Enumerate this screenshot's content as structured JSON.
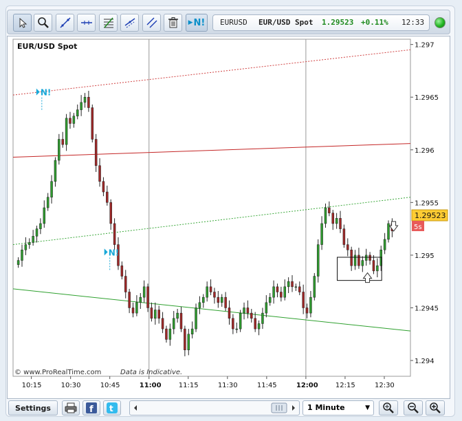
{
  "toolbar": {
    "tools": [
      {
        "name": "pointer-tool-button",
        "icon": "arrow-pointer-icon"
      },
      {
        "name": "zoom-tool-button",
        "icon": "magnifier-icon"
      },
      {
        "name": "trendline-tool-button",
        "icon": "diagonal-line-icon"
      },
      {
        "name": "horizontal-line-tool-button",
        "icon": "horizontal-line-icon"
      },
      {
        "name": "fibonacci-tool-button",
        "icon": "fibonacci-icon"
      },
      {
        "name": "channel-tool-button",
        "icon": "channel-icon"
      },
      {
        "name": "parallel-lines-tool-button",
        "icon": "parallel-lines-icon"
      },
      {
        "name": "delete-tool-button",
        "icon": "trash-icon"
      }
    ],
    "news_label": "N!"
  },
  "quote": {
    "symbol": "EURUSD",
    "name": "EUR/USD Spot",
    "price": "1.29523",
    "change": "+0.11%",
    "time": "12:33",
    "price_color": "#1f8a1f",
    "change_color": "#1f8a1f"
  },
  "chart": {
    "title": "EUR/USD Spot",
    "copyright": "©  www.ProRealTime.com",
    "disclaimer": "Data is Indicative.",
    "news_marker_label": "N!",
    "price_tag": "1.29523",
    "countdown": "5s",
    "price_tag_color": "#ffcc33",
    "countdown_color": "#e85a5a"
  },
  "bottombar": {
    "settings_label": "Settings",
    "interval": "1 Minute",
    "icons": [
      "printer-icon",
      "facebook-icon",
      "twitter-icon",
      "zoom-fit-icon",
      "zoom-out-icon",
      "zoom-in-icon"
    ]
  },
  "chart_data": {
    "type": "candlestick",
    "instrument": "EUR/USD Spot",
    "ylim": [
      1.29385,
      1.29705
    ],
    "y_ticks": [
      "1.297",
      "1.2965",
      "1.296",
      "1.2955",
      "1.295",
      "1.2945",
      "1.294"
    ],
    "x_ticks": [
      "10:15",
      "10:30",
      "10:45",
      "11:00",
      "11:15",
      "11:30",
      "11:45",
      "12:00",
      "12:15",
      "12:30"
    ],
    "x_ticks_bold": [
      "11:00",
      "12:00"
    ],
    "last_price": 1.29523,
    "candle_interval": "1 Minute",
    "series_close": [
      1.29495,
      1.29505,
      1.2951,
      1.29512,
      1.29518,
      1.29525,
      1.2953,
      1.29545,
      1.29555,
      1.2957,
      1.2959,
      1.2961,
      1.29605,
      1.2963,
      1.29625,
      1.29632,
      1.29638,
      1.29645,
      1.2965,
      1.2964,
      1.2961,
      1.29585,
      1.2957,
      1.2956,
      1.2955,
      1.2953,
      1.2951,
      1.2949,
      1.2948,
      1.29465,
      1.2945,
      1.29445,
      1.29455,
      1.2946,
      1.2947,
      1.2945,
      1.2944,
      1.29448,
      1.2944,
      1.2943,
      1.2942,
      1.2943,
      1.2944,
      1.29445,
      1.2943,
      1.2941,
      1.29425,
      1.2943,
      1.2945,
      1.29455,
      1.2946,
      1.2947,
      1.29465,
      1.2946,
      1.29455,
      1.2946,
      1.2945,
      1.2944,
      1.2943,
      1.2943,
      1.29445,
      1.2945,
      1.29445,
      1.2944,
      1.2943,
      1.29435,
      1.29445,
      1.29455,
      1.2946,
      1.2947,
      1.29465,
      1.2946,
      1.2947,
      1.29475,
      1.2947,
      1.2947,
      1.29465,
      1.2945,
      1.29445,
      1.2946,
      1.2948,
      1.2951,
      1.2953,
      1.29545,
      1.2954,
      1.2953,
      1.29535,
      1.29525,
      1.2951,
      1.29505,
      1.2949,
      1.295,
      1.2949,
      1.29495,
      1.295,
      1.29495,
      1.29485,
      1.2949,
      1.29505,
      1.29515,
      1.2953,
      1.29523
    ],
    "channels": [
      {
        "name": "upper-dotted-red",
        "from": [
          "10:08",
          1.29652
        ],
        "to": [
          "12:40",
          1.29695
        ],
        "style": "dotted",
        "color": "#d04040"
      },
      {
        "name": "solid-red",
        "from": [
          "10:08",
          1.29593
        ],
        "to": [
          "12:40",
          1.29606
        ],
        "style": "solid",
        "color": "#c42525"
      },
      {
        "name": "dotted-green",
        "from": [
          "10:08",
          1.2951
        ],
        "to": [
          "12:40",
          1.29555
        ],
        "style": "dotted",
        "color": "#3aa83a"
      },
      {
        "name": "solid-green",
        "from": [
          "10:08",
          1.29468
        ],
        "to": [
          "12:40",
          1.29428
        ],
        "style": "solid",
        "color": "#2ea02e"
      }
    ],
    "annotations": [
      {
        "type": "rectangle",
        "from_time": "12:12",
        "to_time": "12:29",
        "low": 1.29476,
        "high": 1.29498
      },
      {
        "type": "news-marker",
        "time": "10:19",
        "price": 1.29655
      },
      {
        "type": "news-marker",
        "time": "10:45",
        "price": 1.29503
      }
    ],
    "grid": true
  }
}
